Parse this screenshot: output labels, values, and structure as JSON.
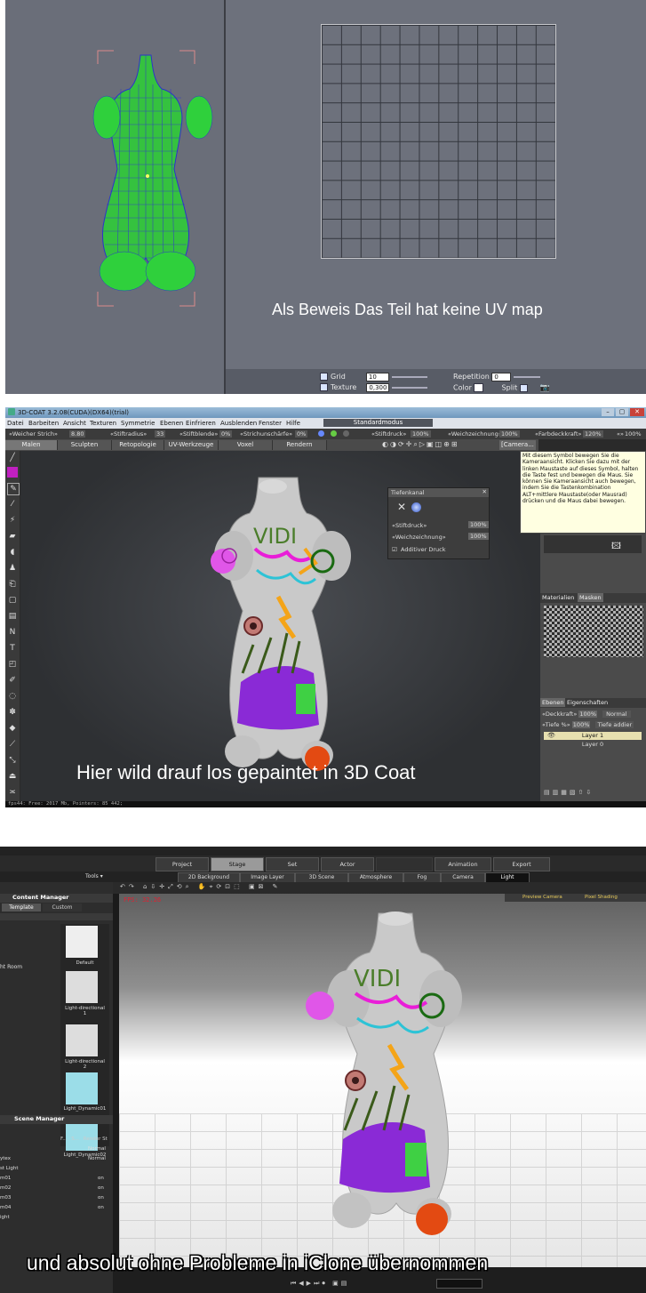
{
  "panel_uv": {
    "caption": "Als Beweis Das Teil hat keine UV map",
    "grid_label": "Grid",
    "grid_value": "10",
    "texture_label": "Texture",
    "texture_value": "0,300",
    "repetition_label": "Repetition",
    "repetition_value": "0",
    "color_label": "Color",
    "split_label": "Split"
  },
  "panel_3dcoat": {
    "window_title": "3D-COAT 3.2.08(CUDA)(DX64)(trial)",
    "menu": [
      "Datei",
      "Barbeiten",
      "Ansicht",
      "Texturen",
      "Symmetrie",
      "Ebenen",
      "Einfrieren",
      "Ausblenden",
      "Fenster",
      "Hilfe"
    ],
    "mode_select": "Standardmodus",
    "toolbar": {
      "brush": "«Weicher Strich»",
      "brush_val": "8.80",
      "radius": "«Stiftradius»",
      "radius_val": "33",
      "blend": "«Stiftblende»",
      "blend_val": "0%",
      "sharp": "«Strichunschärfe»",
      "sharp_val": "0%",
      "pressure": "«Stiftdruck»",
      "pressure_val": "100%",
      "soft": "«Weichzeichnung»",
      "soft_val": "100%",
      "color": "«Farbdeckkraft»",
      "color_val": "120%",
      "extra": "«»",
      "extra_val": "100%"
    },
    "tabs": [
      "Malen",
      "Sculpten",
      "Retopologie",
      "UV-Werkzeuge",
      "Voxel",
      "Rendern"
    ],
    "camera_label": "[Camera...",
    "tiefenkanal": {
      "title": "Tiefenkanal",
      "stiftdruck": "«Stiftdruck»",
      "stiftdruck_val": "100%",
      "weich": "«Weichzeichnung»",
      "weich_val": "100%",
      "additiv": "Additiver Druck"
    },
    "tooltip": "Mit diesem Symbol bewegen Sie die Kameraansicht. Klicken Sie dazu mit der linken Maustaste auf dieses Symbol, halten die Taste fest und bewegen die Maus. Sie können Sie Kameraansicht auch bewegen, indem Sie die Tastenkombination ALT+mittlere Maustaste(oder Mausrad) drücken und die Maus dabei bewegen.",
    "materials_tabs": [
      "Materialien",
      "Masken"
    ],
    "layers_tabs": [
      "Ebenen",
      "Eigenschaften"
    ],
    "deckkraft": "«Deckkraft»",
    "deckkraft_val": "100%",
    "blend_mode": "Normal",
    "tiefe": "«Tiefe %»",
    "tiefe_val": "100%",
    "tiefe_mode": "Tiefe addier",
    "layers": [
      "Layer 1",
      "Layer 0"
    ],
    "model_text": "VIDI",
    "caption": "Hier wild drauf los gepaintet in 3D Coat",
    "status": "fps44:   Free: 2017 Mb, Pointers: 85 442;"
  },
  "panel_iclone": {
    "modes": [
      "Project",
      "Stage",
      "Set",
      "Actor",
      "",
      "Animation",
      "Export"
    ],
    "tools_label": "Tools ▾",
    "subtabs": [
      "2D Background",
      "Image Layer",
      "3D Scene",
      "Atmosphere",
      "Fog",
      "Camera",
      "Light"
    ],
    "content_manager": "Content Manager",
    "cm_tabs": [
      "Template",
      "Custom"
    ],
    "left_tree_item": "ht Room",
    "thumbs": [
      "Default",
      "Light-directional\n1",
      "Light-directional\n2",
      "Light_Dynamic01",
      "Light_Dynamic02"
    ],
    "scene_manager": "Scene Manager",
    "sm_headers": [
      "F...",
      "S...",
      "Render St"
    ],
    "sm_rows": [
      {
        "name": "",
        "col3": "Normal"
      },
      {
        "name": "ytex",
        "col3": "Normal"
      },
      {
        "name": "st Light",
        "col3": ""
      },
      {
        "name": "m01",
        "col3": "on"
      },
      {
        "name": "m02",
        "col3": "on"
      },
      {
        "name": "m03",
        "col3": "on"
      },
      {
        "name": "m04",
        "col3": "on"
      },
      {
        "name": "ight",
        "col3": ""
      }
    ],
    "fps": "FPS: 32.26",
    "preview_camera": "Preview Camera",
    "pixel_shading": "Pixel Shading",
    "model_text": "VIDI",
    "caption": "und absolut ohne Probleme in iClone übernommen"
  },
  "colors": {
    "uv_bg": "#6b6f7b",
    "mesh_green": "#2fbf3a",
    "mesh_blue": "#3a3fd0",
    "coat_bg": "#2a2a2a",
    "iclone_bg": "#1b1b1b"
  }
}
